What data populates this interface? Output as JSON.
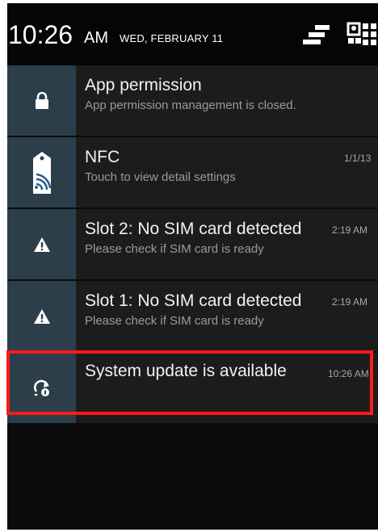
{
  "status_bar": {
    "time": "10:26",
    "ampm": "AM",
    "date": "WED, FEBRUARY 11"
  },
  "icons": {
    "settings": "quick-settings-icon",
    "grid": "notification-grid-icon"
  },
  "notifications": [
    {
      "icon": "lock-icon",
      "title": "App permission",
      "subtitle": "App permission management is closed.",
      "time": ""
    },
    {
      "icon": "nfc-tag-icon",
      "title": "NFC",
      "subtitle": "Touch to view detail settings",
      "time": "1/1/13"
    },
    {
      "icon": "warning-icon",
      "title": "Slot 2: No SIM card detected",
      "subtitle": "Please check if SIM card is ready",
      "time": "2:19 AM"
    },
    {
      "icon": "warning-icon",
      "title": "Slot 1: No SIM card detected",
      "subtitle": "Please check if SIM card is ready",
      "time": "2:19 AM"
    },
    {
      "icon": "system-update-icon",
      "title": "System update is available",
      "subtitle": "",
      "time": "10:26 AM"
    }
  ],
  "colors": {
    "panel_background": "#0b0b0b",
    "card_background": "#1c1c1c",
    "icon_box_background": "#2b3e4a",
    "highlight_border": "#ff1a1a"
  }
}
